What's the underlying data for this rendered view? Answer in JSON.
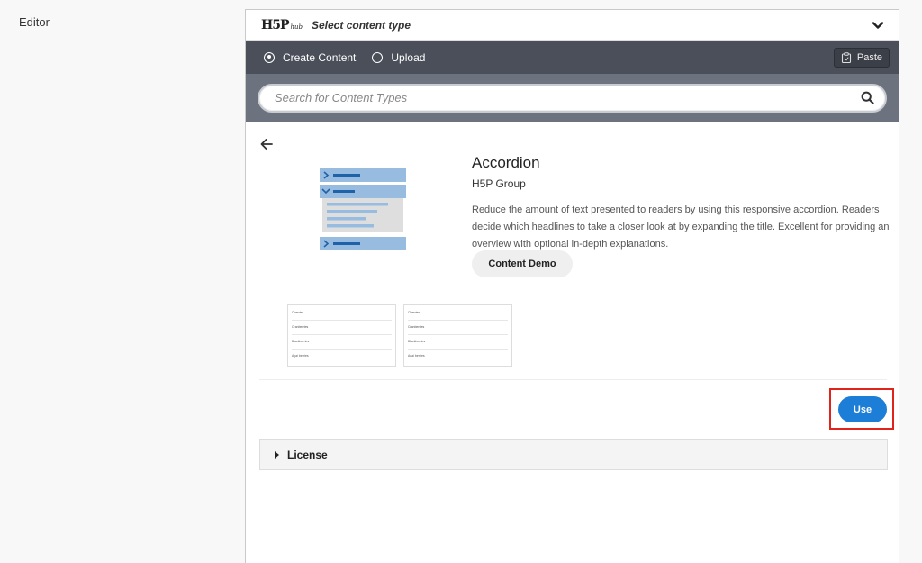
{
  "page": {
    "editor_label": "Editor"
  },
  "hub": {
    "logo_text": "H5P",
    "logo_sub": "hub",
    "title": "Select content type"
  },
  "tabs": {
    "create_label": "Create Content",
    "upload_label": "Upload",
    "selected": "create",
    "paste_label": "Paste"
  },
  "search": {
    "placeholder": "Search for Content Types",
    "value": ""
  },
  "content_type": {
    "title": "Accordion",
    "owner": "H5P Group",
    "description": "Reduce the amount of text presented to readers by using this responsive accordion. Readers decide which headlines to take a closer look at by expanding the title. Excellent for providing an overview with optional in-depth explanations.",
    "demo_label": "Content Demo",
    "use_label": "Use",
    "license_label": "License"
  },
  "screenshots": [
    {
      "items": [
        "Cherries",
        "Cranberries",
        "Blackberries",
        "Açaí berries"
      ]
    },
    {
      "items": [
        "Cherries",
        "Cranberries",
        "Blackberries",
        "Açaí berries"
      ]
    }
  ],
  "colors": {
    "accent": "#1c7ed6",
    "tabbar": "#4a4f59",
    "searchbar": "#6c737f",
    "highlight": "#e0241b"
  }
}
